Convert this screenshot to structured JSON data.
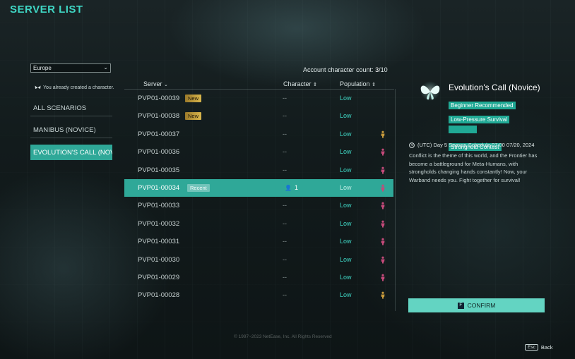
{
  "title": "SERVER LIST",
  "region": {
    "selected": "Europe"
  },
  "notice": "You already created a character.",
  "scenarios": [
    {
      "label": "ALL SCENARIOS"
    },
    {
      "label": "MANIBUS (NOVICE)"
    },
    {
      "label": "EVOLUTION'S CALL (NOVI"
    }
  ],
  "account": {
    "label": "Account character count:",
    "count": "3",
    "total": "/10"
  },
  "table": {
    "headers": {
      "server": "Server",
      "character": "Character",
      "population": "Population"
    },
    "rows": [
      {
        "server": "PVP01-00039",
        "tag": "New",
        "character": "--",
        "population": "Low",
        "icon": "",
        "icon_color": ""
      },
      {
        "server": "PVP01-00038",
        "tag": "New",
        "character": "--",
        "population": "Low",
        "icon": "",
        "icon_color": ""
      },
      {
        "server": "PVP01-00037",
        "tag": "",
        "character": "--",
        "population": "Low",
        "icon": "figure-icon",
        "icon_color": "#c79a3c"
      },
      {
        "server": "PVP01-00036",
        "tag": "",
        "character": "--",
        "population": "Low",
        "icon": "figure-icon",
        "icon_color": "#c44a7a"
      },
      {
        "server": "PVP01-00035",
        "tag": "",
        "character": "--",
        "population": "Low",
        "icon": "figure-icon",
        "icon_color": "#c44a7a"
      },
      {
        "server": "PVP01-00034",
        "tag": "Recent",
        "character": "1",
        "population": "Low",
        "icon": "figure-icon",
        "icon_color": "#c44a7a",
        "selected": true
      },
      {
        "server": "PVP01-00033",
        "tag": "",
        "character": "--",
        "population": "Low",
        "icon": "figure-icon",
        "icon_color": "#c44a7a"
      },
      {
        "server": "PVP01-00032",
        "tag": "",
        "character": "--",
        "population": "Low",
        "icon": "figure-icon",
        "icon_color": "#c44a7a"
      },
      {
        "server": "PVP01-00031",
        "tag": "",
        "character": "--",
        "population": "Low",
        "icon": "figure-icon",
        "icon_color": "#c44a7a"
      },
      {
        "server": "PVP01-00030",
        "tag": "",
        "character": "--",
        "population": "Low",
        "icon": "figure-icon",
        "icon_color": "#c44a7a"
      },
      {
        "server": "PVP01-00029",
        "tag": "",
        "character": "--",
        "population": "Low",
        "icon": "figure-icon",
        "icon_color": "#c44a7a"
      },
      {
        "server": "PVP01-00028",
        "tag": "",
        "character": "--",
        "population": "Low",
        "icon": "figure-icon",
        "icon_color": "#c79a3c"
      }
    ]
  },
  "detail": {
    "title": "Evolution's Call (Novice)",
    "tags": [
      "Beginner Recommended",
      "Low-Pressure Survival",
      "",
      "Stronghold Contest"
    ],
    "schedule": "(UTC) Day 5   Season Schedule 07:00 07/20, 2024",
    "description": "Conflict is the theme of this world, and the Frontier has become a battleground for Meta-Humans, with strongholds changing hands constantly! Now, your Warband needs you. Fight together for survival!"
  },
  "confirm": {
    "key": "F",
    "label": "CONFIRM"
  },
  "copyright": "© 1997~2023 NetEase, Inc. All Rights Reserved",
  "back": {
    "key": "Esc",
    "label": "Back"
  },
  "colors": {
    "accent": "#3fd6c4",
    "selected_row": "#2fa898",
    "new_tag": "#d8b64c",
    "confirm": "#63d4c2"
  }
}
